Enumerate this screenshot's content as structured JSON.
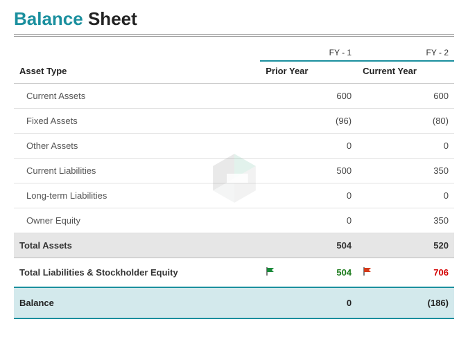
{
  "title": {
    "part1": "Balance",
    "part2": "Sheet"
  },
  "columns": {
    "asset_type": "Asset Type",
    "fy1": {
      "code": "FY - 1",
      "label": "Prior Year"
    },
    "fy2": {
      "code": "FY - 2",
      "label": "Current Year"
    }
  },
  "rows": [
    {
      "label": "Current Assets",
      "fy1": "600",
      "fy1_neg": false,
      "fy2": "600",
      "fy2_neg": false
    },
    {
      "label": "Fixed Assets",
      "fy1": "(96)",
      "fy1_neg": true,
      "fy2": "(80)",
      "fy2_neg": true
    },
    {
      "label": "Other Assets",
      "fy1": "0",
      "fy1_neg": false,
      "fy2": "0",
      "fy2_neg": false
    },
    {
      "label": "Current Liabilities",
      "fy1": "500",
      "fy1_neg": false,
      "fy2": "350",
      "fy2_neg": false
    },
    {
      "label": "Long-term Liabilities",
      "fy1": "0",
      "fy1_neg": false,
      "fy2": "0",
      "fy2_neg": false
    },
    {
      "label": "Owner Equity",
      "fy1": "0",
      "fy1_neg": false,
      "fy2": "350",
      "fy2_neg": false
    }
  ],
  "total_assets": {
    "label": "Total Assets",
    "fy1": "504",
    "fy2": "520"
  },
  "equity": {
    "label": "Total Liabilities & Stockholder Equity",
    "fy1": {
      "value": "504",
      "flag": "green"
    },
    "fy2": {
      "value": "706",
      "flag": "red"
    }
  },
  "balance": {
    "label": "Balance",
    "fy1": "0",
    "fy1_neg": false,
    "fy2": "(186)",
    "fy2_neg": true
  },
  "chart_data": {
    "type": "table",
    "title": "Balance Sheet",
    "columns": [
      "Asset Type",
      "FY - 1 (Prior Year)",
      "FY - 2 (Current Year)"
    ],
    "rows": [
      [
        "Current Assets",
        600,
        600
      ],
      [
        "Fixed Assets",
        -96,
        -80
      ],
      [
        "Other Assets",
        0,
        0
      ],
      [
        "Current Liabilities",
        500,
        350
      ],
      [
        "Long-term Liabilities",
        0,
        0
      ],
      [
        "Owner Equity",
        0,
        350
      ],
      [
        "Total Assets",
        504,
        520
      ],
      [
        "Total Liabilities & Stockholder Equity",
        504,
        706
      ],
      [
        "Balance",
        0,
        -186
      ]
    ]
  }
}
